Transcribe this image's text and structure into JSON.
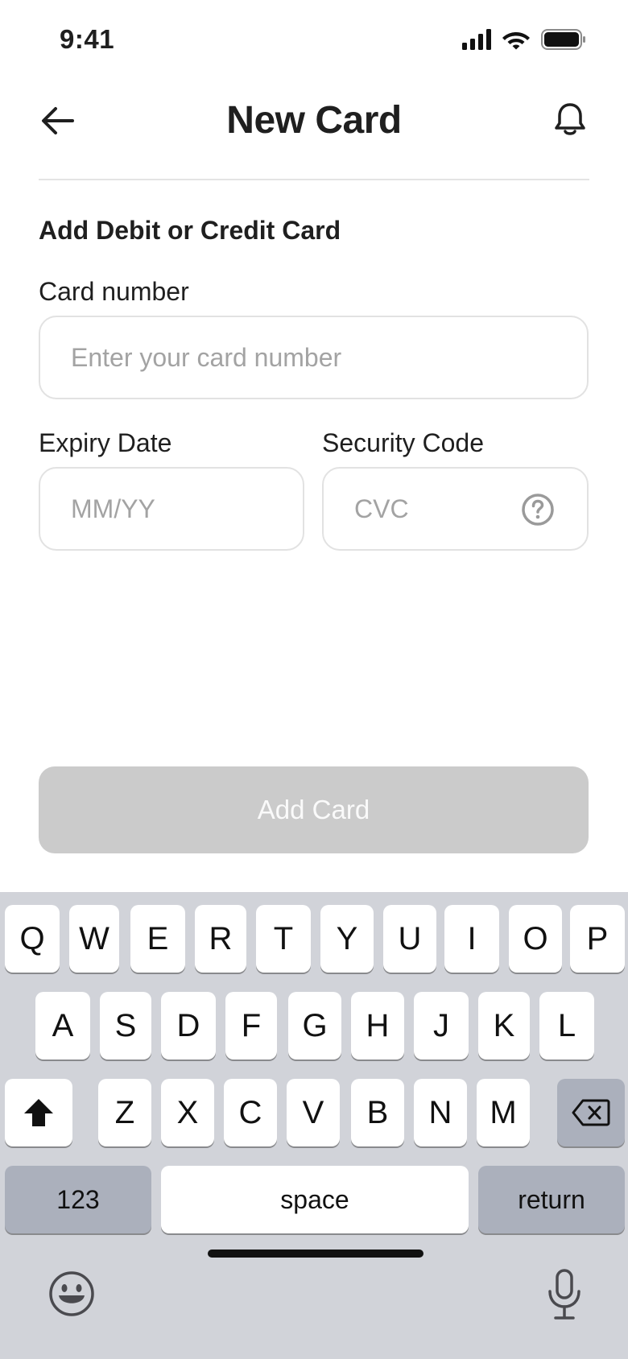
{
  "status_bar": {
    "time": "9:41",
    "icons": [
      "signal-icon",
      "wifi-icon",
      "battery-icon"
    ]
  },
  "nav": {
    "title": "New Card",
    "back_icon": "arrow-left-icon",
    "bell_icon": "bell-icon"
  },
  "form": {
    "section_title": "Add Debit or Credit Card",
    "card_number": {
      "label": "Card number",
      "placeholder": "Enter your card number",
      "value": ""
    },
    "expiry": {
      "label": "Expiry Date",
      "placeholder": "MM/YY",
      "value": ""
    },
    "security": {
      "label": "Security Code",
      "placeholder": "CVC",
      "value": "",
      "help_icon": "question-circle-icon"
    },
    "submit_label": "Add Card"
  },
  "keyboard": {
    "row1": [
      "Q",
      "W",
      "E",
      "R",
      "T",
      "Y",
      "U",
      "I",
      "O",
      "P"
    ],
    "row2": [
      "A",
      "S",
      "D",
      "F",
      "G",
      "H",
      "J",
      "K",
      "L"
    ],
    "row3": [
      "Z",
      "X",
      "C",
      "V",
      "B",
      "N",
      "M"
    ],
    "numbers_label": "123",
    "space_label": "space",
    "return_label": "return",
    "icons": [
      "shift-icon",
      "backspace-icon",
      "emoji-icon",
      "microphone-icon"
    ]
  },
  "colors": {
    "button_disabled": "#cbcbcb",
    "keyboard_bg": "#d1d3d9",
    "placeholder": "#a3a3a3",
    "border": "#e2e2e2"
  }
}
